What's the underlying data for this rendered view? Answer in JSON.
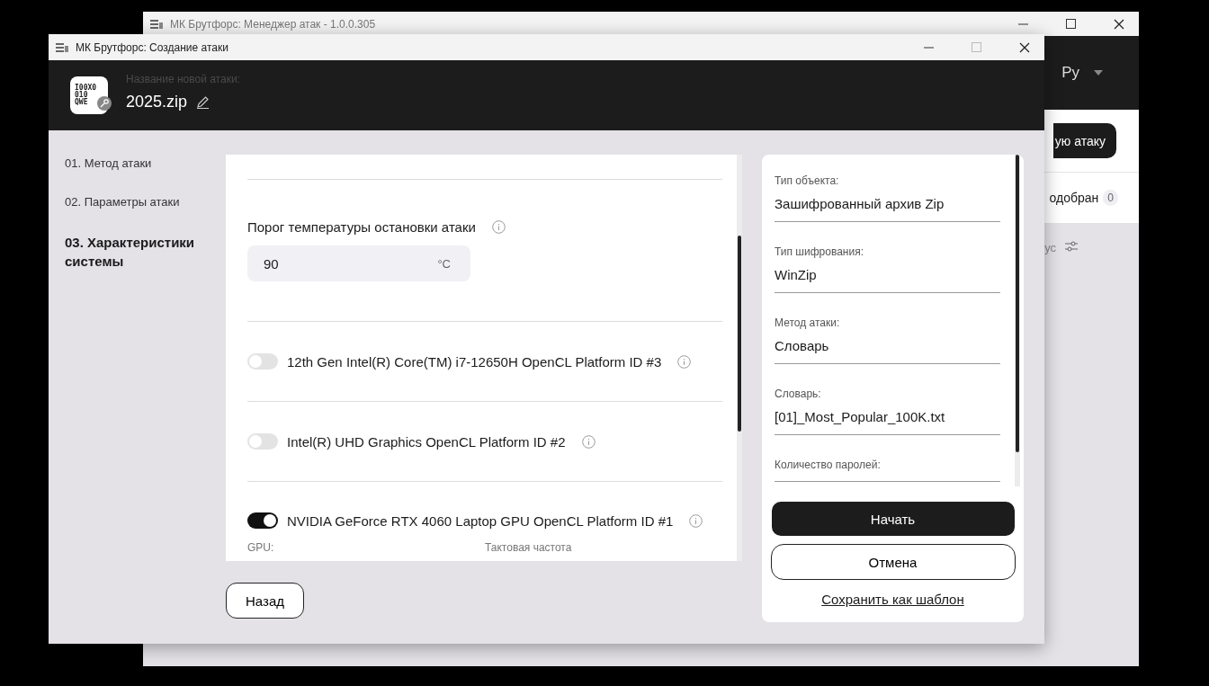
{
  "back_window": {
    "title": "МК Брутфорс: Менеджер атак - 1.0.0.305",
    "language": "Ру",
    "action_button": "ую атаку",
    "tab": {
      "label": "одобран",
      "count": "0"
    },
    "filter_label": "ус"
  },
  "window": {
    "title": "МК Брутфорс: Создание атаки",
    "maximize_disabled": true
  },
  "header": {
    "logo_lines": [
      "I00X0",
      "010",
      "QWE"
    ],
    "caption": "Название новой атаки:",
    "name": "2025.zip"
  },
  "steps": [
    {
      "label": "01. Метод атаки",
      "selected": false
    },
    {
      "label": "02. Параметры атаки",
      "selected": false
    },
    {
      "label": "03. Характеристики системы",
      "selected": true
    }
  ],
  "settings": {
    "temperature": {
      "label": "Порог температуры остановки атаки",
      "value": "90",
      "unit": "°C"
    },
    "devices": [
      {
        "name": "12th Gen Intel(R) Core(TM) i7-12650H OpenCL Platform ID #3",
        "on": false
      },
      {
        "name": "Intel(R) UHD Graphics OpenCL Platform ID #2",
        "on": false
      },
      {
        "name": "NVIDIA GeForce RTX 4060 Laptop GPU OpenCL Platform ID #1",
        "on": true
      }
    ],
    "details": [
      "GPU:",
      "Тактовая частота"
    ]
  },
  "back_button": "Назад",
  "summary": {
    "fields": [
      {
        "label": "Тип объекта:",
        "value": "Зашифрованный архив Zip"
      },
      {
        "label": "Тип шифрования:",
        "value": "WinZip"
      },
      {
        "label": "Метод атаки:",
        "value": "Словарь"
      },
      {
        "label": "Словарь:",
        "value": "[01]_Most_Popular_100K.txt"
      },
      {
        "label": "Количество паролей:"
      }
    ],
    "start": "Начать",
    "cancel": "Отмена",
    "save_template": "Сохранить как шаблон"
  }
}
